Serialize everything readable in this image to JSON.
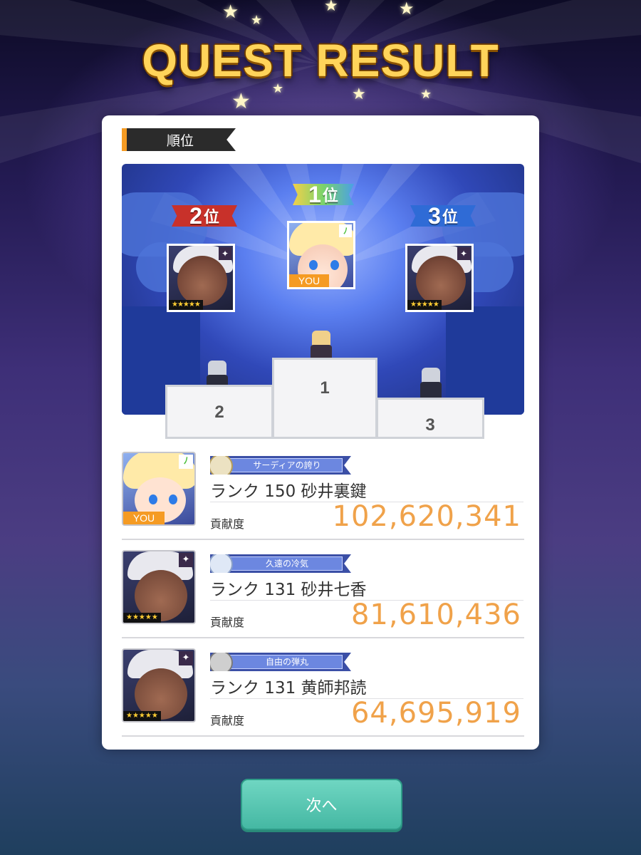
{
  "screen": {
    "title": "QUEST RESULT"
  },
  "section": {
    "label": "順位"
  },
  "podium": {
    "first": {
      "rank_num": "1",
      "suffix": "位",
      "you": "YOU",
      "step": "1"
    },
    "second": {
      "rank_num": "2",
      "suffix": "位",
      "step": "2"
    },
    "third": {
      "rank_num": "3",
      "suffix": "位",
      "step": "3"
    }
  },
  "rows": [
    {
      "title": "サーディアの誇り",
      "rank": "ランク 150 砂井裏鍵",
      "contrib_label": "貢献度",
      "contrib": "102,620,341",
      "you": "YOU"
    },
    {
      "title": "久遠の冷気",
      "rank": "ランク 131 砂井七香",
      "contrib_label": "貢献度",
      "contrib": "81,610,436"
    },
    {
      "title": "自由の弾丸",
      "rank": "ランク 131 黄師邦読",
      "contrib_label": "貢献度",
      "contrib": "64,695,919"
    }
  ],
  "stars_badge": "★★★★★",
  "next_button": {
    "label": "次へ"
  },
  "colors": {
    "accent": "#f59b23",
    "contrib": "#f0a24a",
    "button": "#5cc8b4"
  },
  "icons": {
    "leaf": "leaf-icon",
    "sparkle": "sparkle-icon"
  }
}
